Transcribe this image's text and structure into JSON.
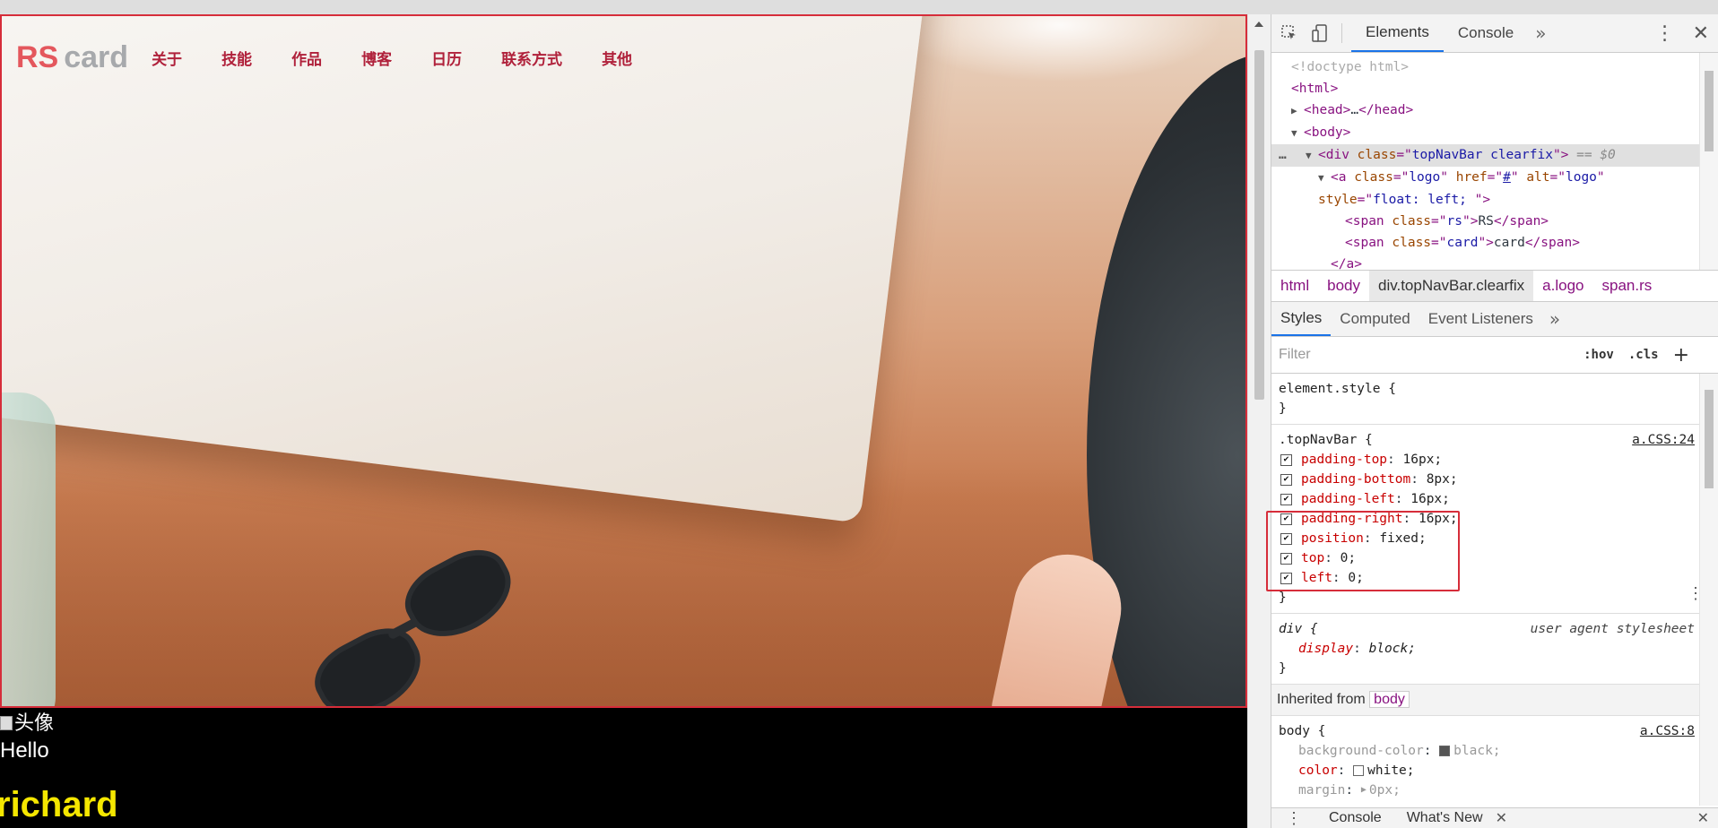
{
  "page": {
    "nav": {
      "logo_rs": "RS",
      "logo_card": "card",
      "links": [
        "关于",
        "技能",
        "作品",
        "博客",
        "日历",
        "联系方式",
        "其他"
      ]
    },
    "avatar_alt": "头像",
    "hello": "Hello",
    "name": "richard"
  },
  "devtools": {
    "tabs": [
      "Elements",
      "Console"
    ],
    "more": "»",
    "dom": {
      "lines": [
        {
          "kind": "comment",
          "text": "<!doctype html>"
        },
        {
          "kind": "simple",
          "text_open": "<",
          "tag": "html",
          "text_close": ">"
        },
        {
          "kind": "collapsed",
          "tag_open": "<head>",
          "ellipsis": "…",
          "tag_close": "</head>"
        },
        {
          "kind": "simple",
          "text_open": "<",
          "tag": "body",
          "text_close": ">"
        }
      ],
      "selected": {
        "tag": "div",
        "attr": "class",
        "value": "topNavBar clearfix",
        "suffix": "== $0"
      },
      "a_line": {
        "tag": "a",
        "attrs": [
          {
            "name": "class",
            "value": "logo"
          },
          {
            "name": "href",
            "value": "#"
          },
          {
            "name": "alt",
            "value": "logo"
          }
        ],
        "style_attr": "style",
        "style_value": "float: left; "
      },
      "spans": [
        {
          "class": "rs",
          "text": "RS"
        },
        {
          "class": "card",
          "text": "card"
        }
      ],
      "close_a": "</a>"
    },
    "breadcrumbs": [
      "html",
      "body",
      "div.topNavBar.clearfix",
      "a.logo",
      "span.rs"
    ],
    "styles_tabs": [
      "Styles",
      "Computed",
      "Event Listeners"
    ],
    "filter_placeholder": "Filter",
    "hov": ":hov",
    "cls": ".cls",
    "rules": {
      "element_style": "element.style {",
      "close": "}",
      "topnav": {
        "selector": ".topNavBar {",
        "source": "a.CSS:24",
        "decls": [
          {
            "prop": "padding-top",
            "val": "16px;"
          },
          {
            "prop": "padding-bottom",
            "val": "8px;"
          },
          {
            "prop": "padding-left",
            "val": "16px;"
          },
          {
            "prop": "padding-right",
            "val": "16px;"
          },
          {
            "prop": "position",
            "val": "fixed;"
          },
          {
            "prop": "top",
            "val": "0;"
          },
          {
            "prop": "left",
            "val": "0;"
          }
        ]
      },
      "div_rule": {
        "selector": "div {",
        "source": "user agent stylesheet",
        "prop": "display",
        "val": "block;"
      },
      "inherited_label": "Inherited from",
      "inherited_from": "body",
      "body_rule": {
        "selector": "body {",
        "source": "a.CSS:8",
        "decls": [
          {
            "prop": "background-color",
            "val": "black;"
          },
          {
            "prop": "color",
            "val": "white;"
          },
          {
            "prop": "margin",
            "val": "0px;"
          }
        ]
      }
    },
    "drawer": [
      "Console",
      "What's New"
    ]
  }
}
